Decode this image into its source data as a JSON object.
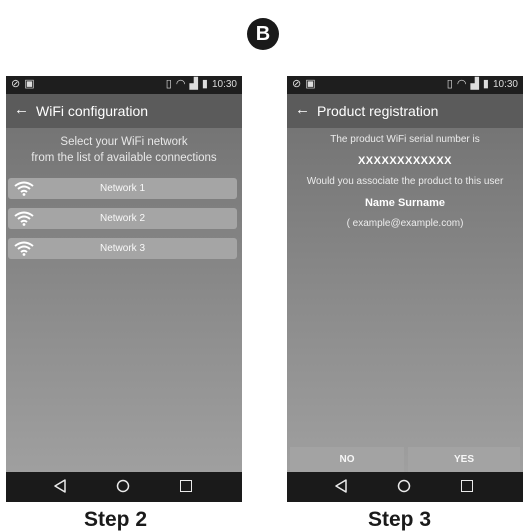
{
  "badge": "B",
  "status_bar": {
    "time": "10:30"
  },
  "left_screen": {
    "title": "WiFi configuration",
    "instructions": [
      "Select your WiFi network",
      "from the list of available connections"
    ],
    "networks": [
      "Network 1",
      "Network 2",
      "Network 3"
    ]
  },
  "right_screen": {
    "title": "Product registration",
    "serial_intro": "The product WiFi serial number is",
    "serial": "XXXXXXXXXXXX",
    "question": "Would you associate the product to this user",
    "user_name": "Name Surname",
    "user_email": "( example@example.com)",
    "no_label": "NO",
    "yes_label": "YES"
  },
  "captions": {
    "left": "Step 2",
    "right": "Step 3"
  },
  "icons": [
    "back-arrow-icon",
    "wifi-icon",
    "nav-back-icon",
    "nav-home-icon",
    "nav-recent-icon",
    "signal-icon",
    "battery-icon",
    "vibrate-icon"
  ]
}
